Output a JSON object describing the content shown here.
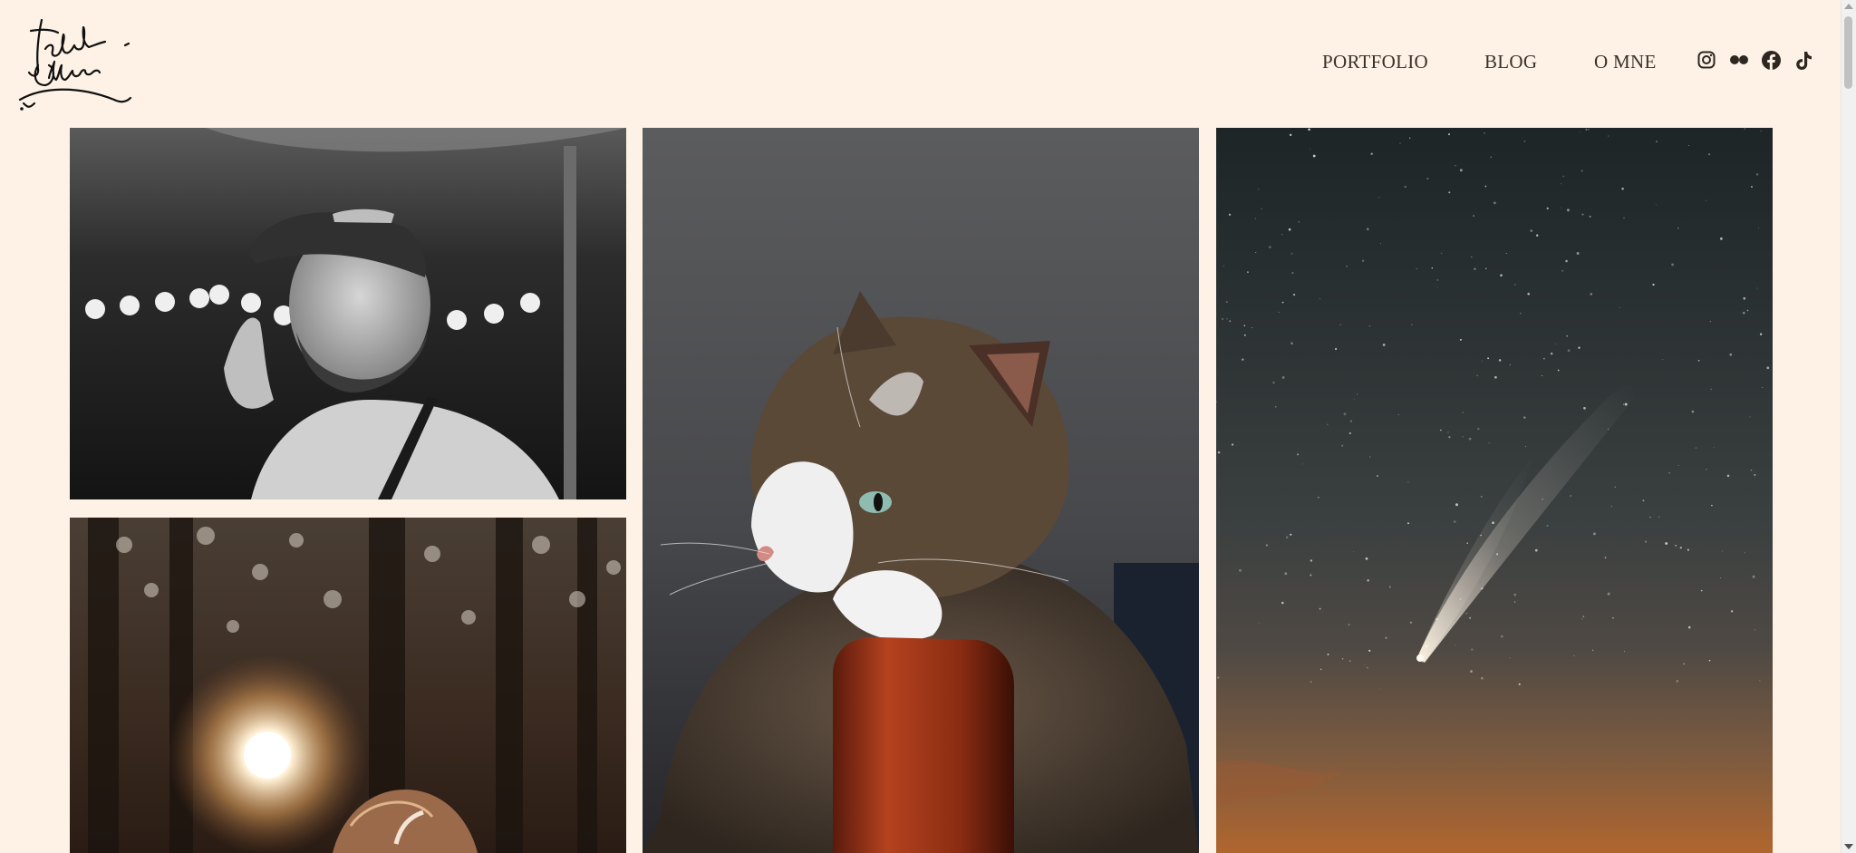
{
  "site": {
    "logo_alt": "Jakub Olahna signature logo",
    "background_color": "#fdf2e5",
    "text_color": "#3a3128"
  },
  "nav": {
    "items": [
      {
        "label": "PORTFOLIO"
      },
      {
        "label": "BLOG"
      },
      {
        "label": "O MNE"
      }
    ]
  },
  "social": {
    "icons": [
      "instagram-icon",
      "flickr-icon",
      "facebook-icon",
      "tiktok-icon"
    ]
  },
  "gallery": {
    "photos": [
      {
        "alt": "Black and white portrait of a smiling bearded man in a cap"
      },
      {
        "alt": "Tabby and white cat resting its paws on a wooden post"
      },
      {
        "alt": "Comet with a long tail in a starry night sky over orange horizon"
      },
      {
        "alt": "Sunlight flaring through a forest behind a person's hair"
      }
    ]
  }
}
